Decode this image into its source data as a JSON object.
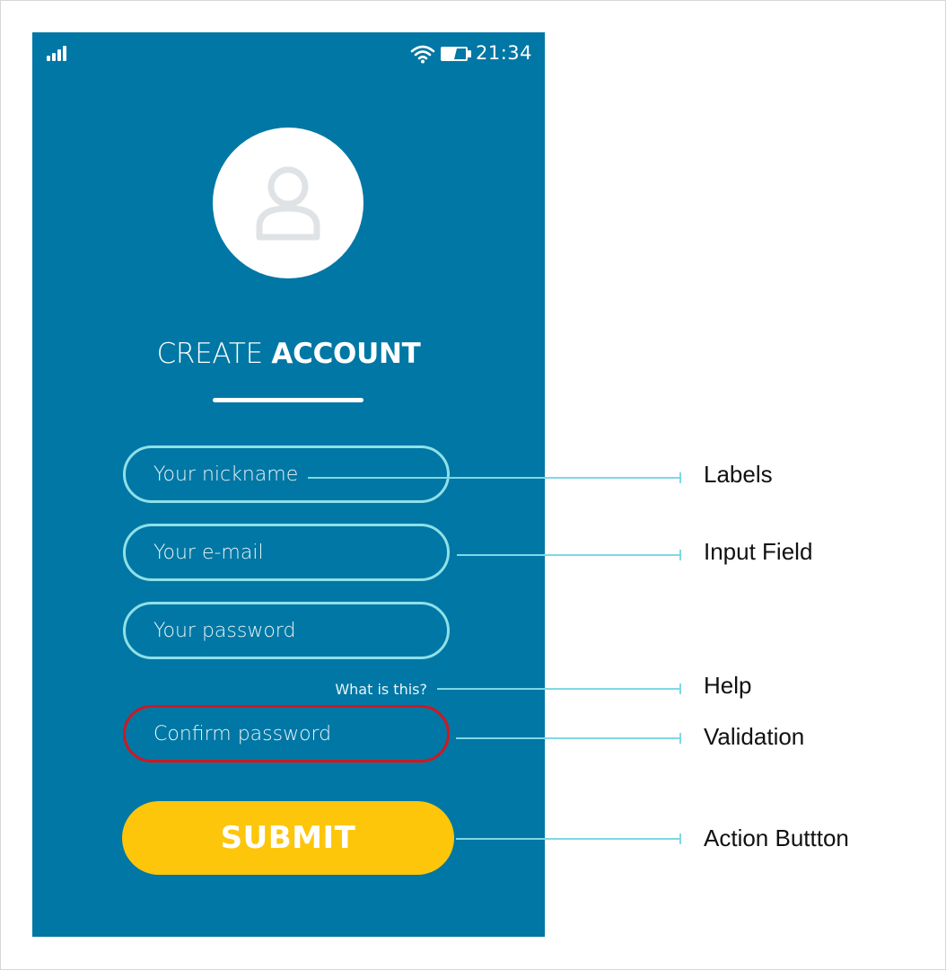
{
  "status_bar": {
    "time": "21:34",
    "signal_icon": "signal-icon",
    "wifi_icon": "wifi-icon",
    "battery_icon": "battery-icon"
  },
  "avatar": {
    "icon": "user-icon"
  },
  "title": {
    "light": "CREATE ",
    "bold": "ACCOUNT"
  },
  "form": {
    "nickname_placeholder": "Your nickname",
    "email_placeholder": "Your e-mail",
    "password_placeholder": "Your password",
    "help_link": "What is this?",
    "confirm_placeholder": "Confirm password",
    "submit_label": "SUBMIT"
  },
  "annotations": {
    "labels": "Labels",
    "input_field": "Input Field",
    "help": "Help",
    "validation": "Validation",
    "action_button": "Action Buttton"
  },
  "colors": {
    "phone_background": "#0077a4",
    "field_border": "#8fe0e8",
    "error_border": "#d0181f",
    "submit_background": "#fdc60a",
    "connector": "#7fd8e4"
  }
}
